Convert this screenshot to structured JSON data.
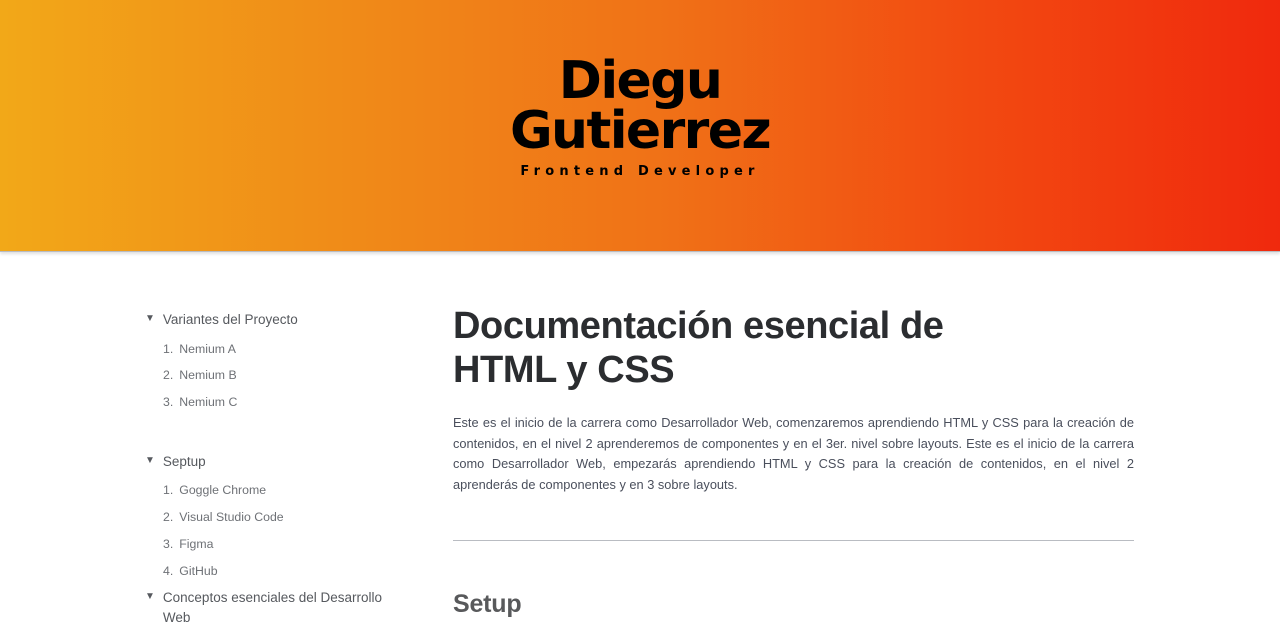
{
  "header": {
    "brand_first": "Diegu",
    "brand_last": "Gutierrez",
    "tagline": "Frontend Developer",
    "gradient_start": "#f2a818",
    "gradient_end": "#f0290d",
    "text_color": "#000000"
  },
  "sidebar": {
    "caret_icon": "▼",
    "groups": [
      {
        "title": "Variantes del Proyecto",
        "items": [
          {
            "index": "1.",
            "label": "Nemium A"
          },
          {
            "index": "2.",
            "label": "Nemium B"
          },
          {
            "index": "3.",
            "label": "Nemium C"
          }
        ]
      },
      {
        "title": "Septup",
        "items": [
          {
            "index": "1.",
            "label": "Goggle Chrome"
          },
          {
            "index": "2.",
            "label": "Visual Studio Code"
          },
          {
            "index": "3.",
            "label": "Figma"
          },
          {
            "index": "4.",
            "label": "GitHub"
          }
        ]
      },
      {
        "title": "Conceptos esenciales del Desarrollo Web",
        "items": []
      }
    ]
  },
  "main": {
    "title": "Documentación esencial de HTML y CSS",
    "intro": "Este es el inicio de la carrera como Desarrollador Web, comenzaremos aprendiendo HTML y CSS para la creación de contenidos, en el nivel 2 aprenderemos de componentes y en el 3er. nivel sobre layouts. Este es el inicio de la carrera como Desarrollador Web, empezarás aprendiendo HTML y CSS para la creación de contenidos, en el nivel 2 aprenderás de componentes y en 3 sobre layouts.",
    "section_heading": "Setup",
    "title_color": "#2b2d30",
    "body_color": "#4a4f5c",
    "heading_color": "#58595b",
    "rule_color": "#b9bcc2"
  }
}
